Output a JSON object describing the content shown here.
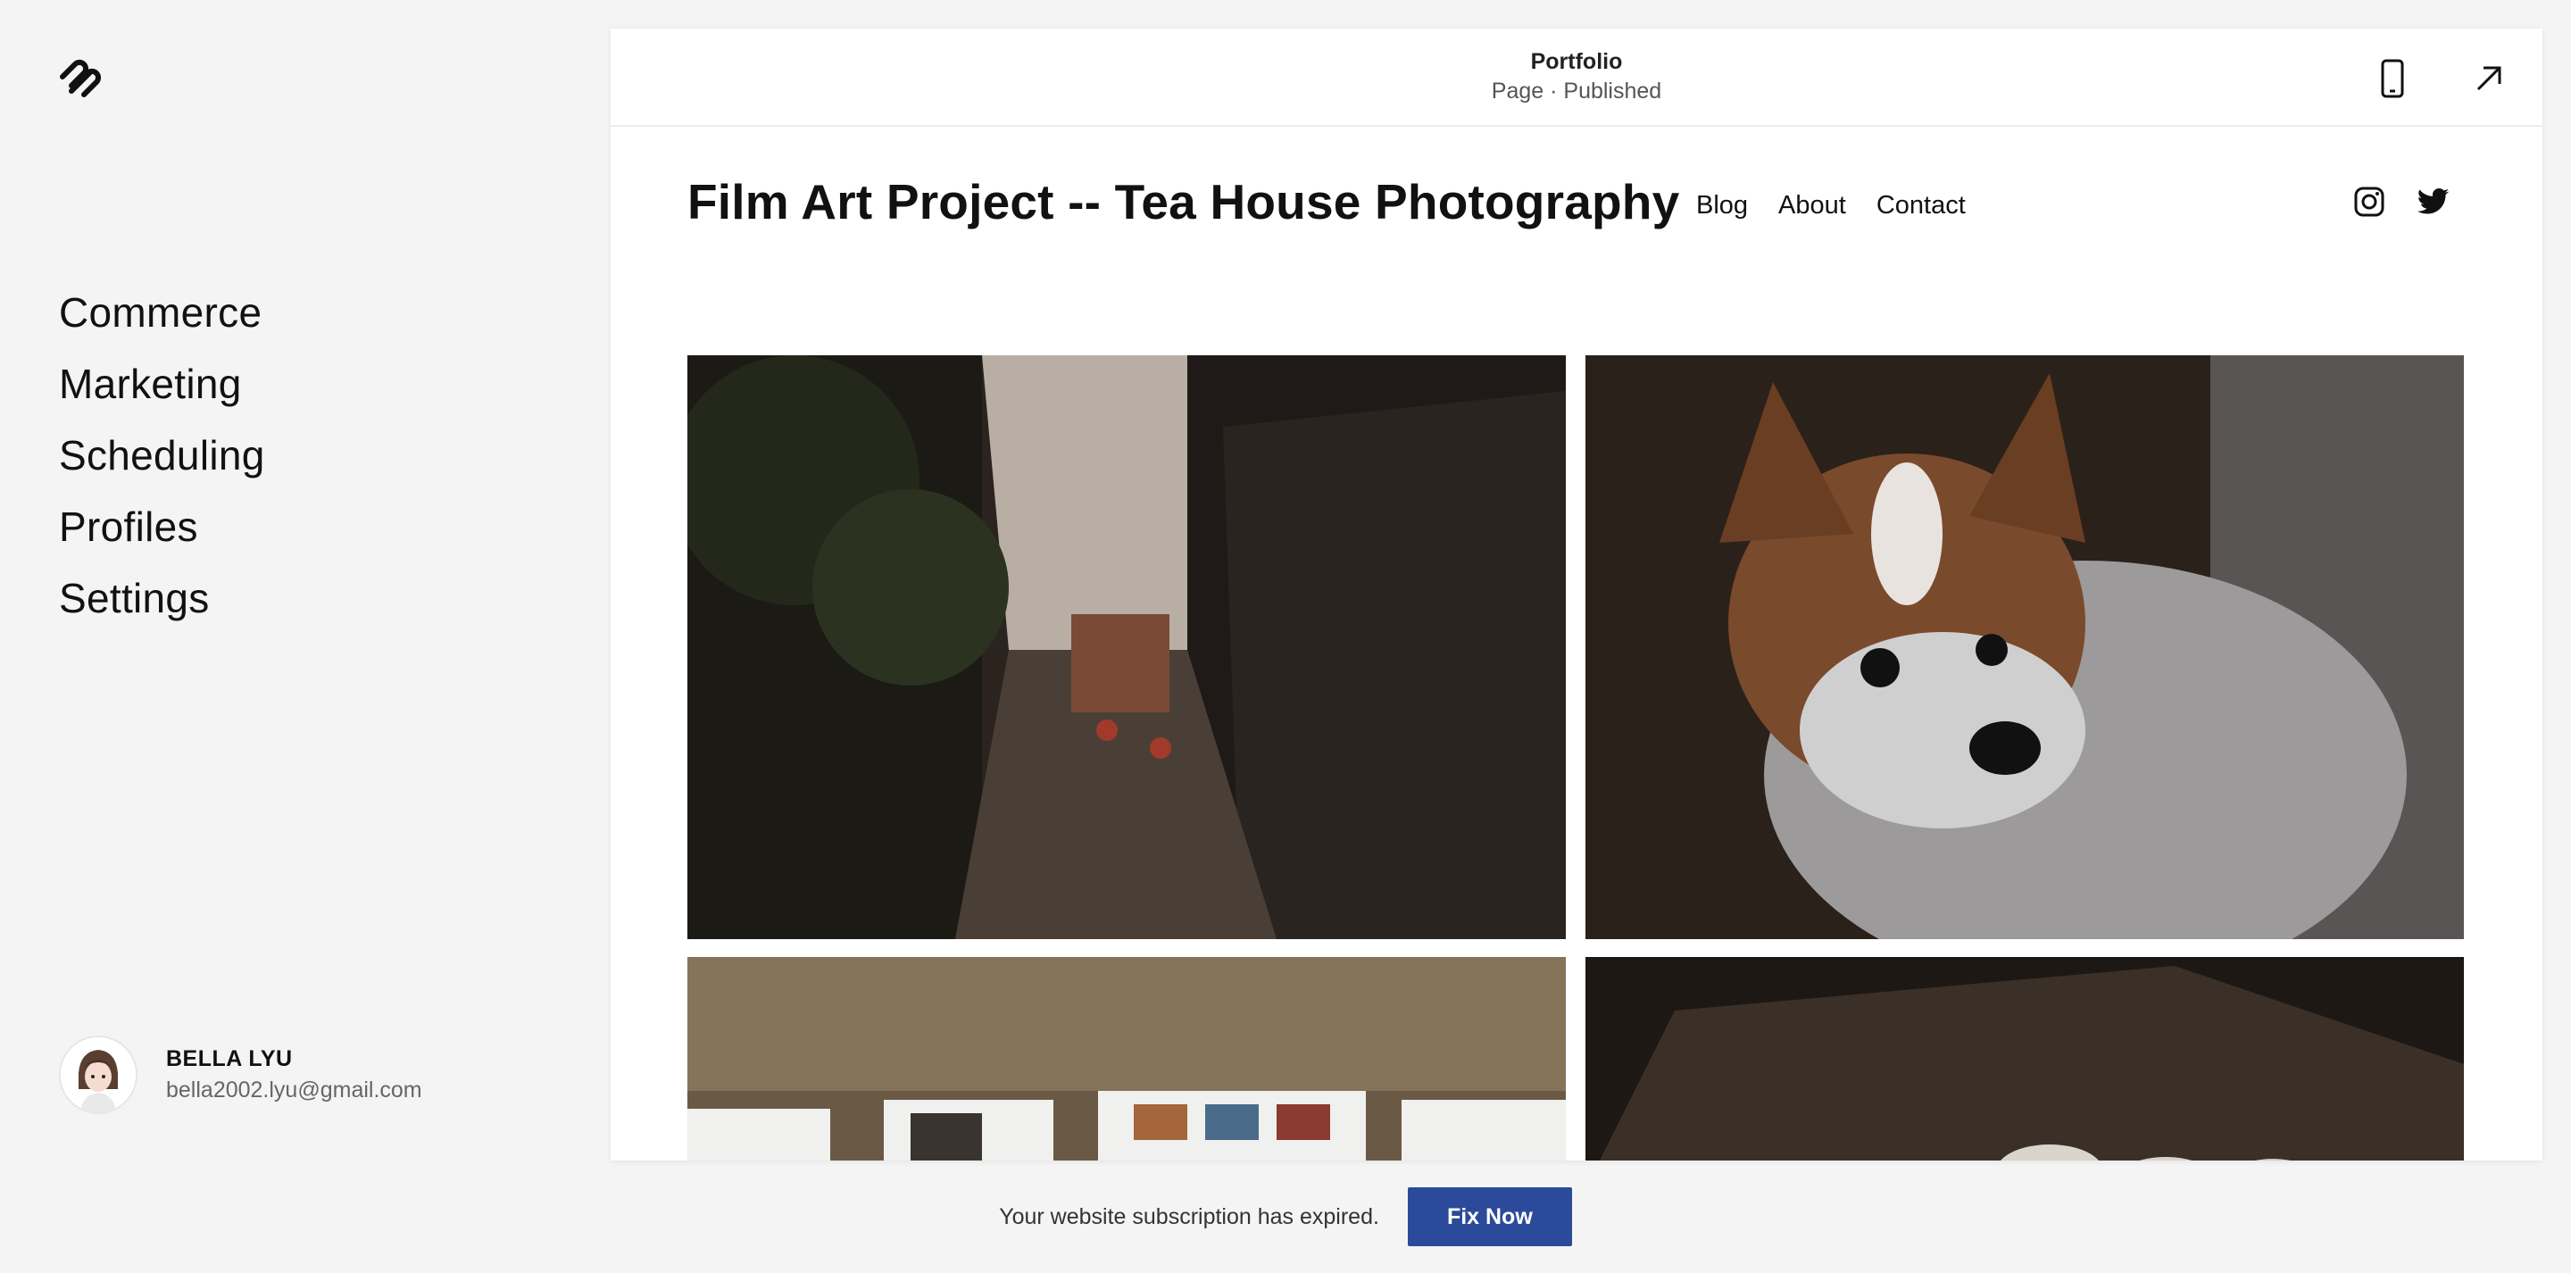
{
  "sidebar": {
    "logo_icon": "squarespace-logo-icon",
    "nav_items": [
      {
        "label": "Commerce"
      },
      {
        "label": "Marketing"
      },
      {
        "label": "Scheduling"
      },
      {
        "label": "Profiles"
      },
      {
        "label": "Settings"
      }
    ],
    "profile": {
      "name": "BELLA LYU",
      "email": "bella2002.lyu@gmail.com"
    }
  },
  "panel": {
    "page_title": "Portfolio",
    "page_status": "Page · Published",
    "icons": {
      "mobile_preview": "mobile-preview-icon",
      "open_external": "open-external-icon"
    }
  },
  "site": {
    "title": "Film Art Project -- Tea House Photography",
    "nav": [
      "Blog",
      "About",
      "Contact"
    ],
    "social_icons": [
      "instagram-icon",
      "twitter-icon"
    ]
  },
  "banner": {
    "message": "Your website subscription has expired.",
    "button_label": "Fix Now",
    "button_color": "#2c4a9a"
  }
}
